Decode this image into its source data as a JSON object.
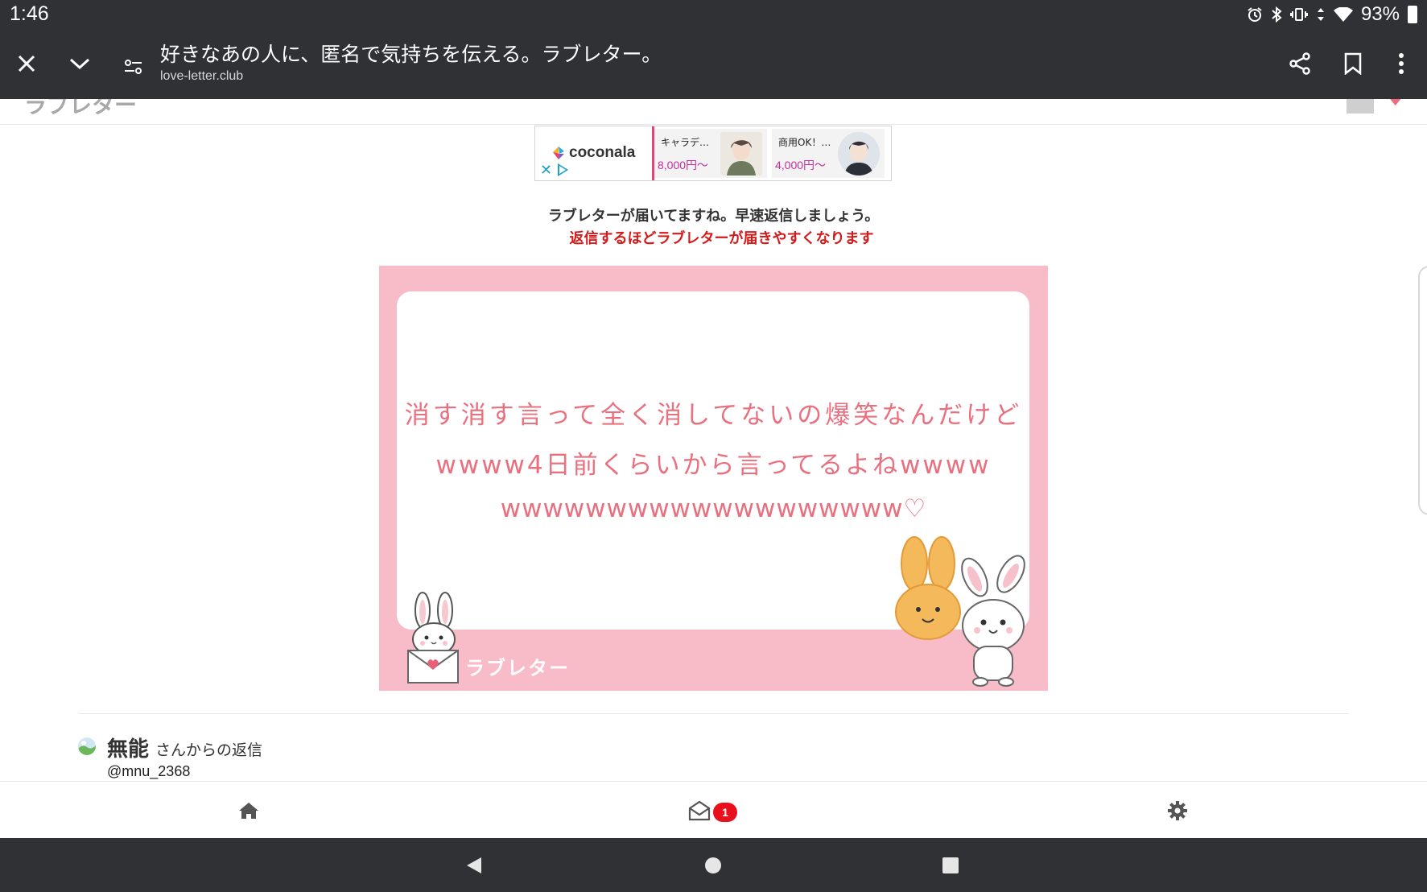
{
  "status_bar": {
    "time": "1:46",
    "battery": "93%",
    "icons": [
      "alarm-icon",
      "bluetooth-icon",
      "vibrate-icon",
      "data-arrows-icon",
      "wifi-icon",
      "battery-icon"
    ]
  },
  "browser": {
    "title": "好きなあの人に、匿名で気持ちを伝える。ラブレター。",
    "url": "love-letter.club",
    "buttons": [
      "close-icon",
      "chevron-down-icon",
      "page-settings-icon",
      "share-icon",
      "bookmark-icon",
      "more-vert-icon"
    ]
  },
  "header": {
    "logo": "ラブレター"
  },
  "ad": {
    "brand": "coconala",
    "items": [
      {
        "title": "キャラデ…",
        "price": "8,000円〜"
      },
      {
        "title": "商用OK！…",
        "price": "4,000円〜"
      }
    ]
  },
  "notice": {
    "line1": "ラブレターが届いてますね。早速返信しましょう。",
    "line2": "返信するほどラブレターが届きやすくなります"
  },
  "letter": {
    "lines": [
      "消す消す言って全く消してないの爆笑なんだけど",
      "wwww4日前くらいから言ってるよねwwww",
      "wwwwwwwwwwwwwwwwwww♡"
    ],
    "brand": "ラブレター"
  },
  "reply": {
    "name": "無能",
    "suffix": "さんからの返信",
    "handle": "@mnu_2368"
  },
  "bottom_nav": {
    "items": [
      "home-icon",
      "mail-icon",
      "settings-icon"
    ],
    "badge": "1"
  },
  "system_nav": [
    "back-icon",
    "home-circle-icon",
    "recents-icon"
  ],
  "colors": {
    "bar_dark": "#2f3135",
    "card_pink": "#f8bcc8",
    "letter_text": "#e8707f",
    "notice_red": "#d61a1a",
    "badge_red": "#e8101c",
    "ad_price": "#c3309a"
  }
}
